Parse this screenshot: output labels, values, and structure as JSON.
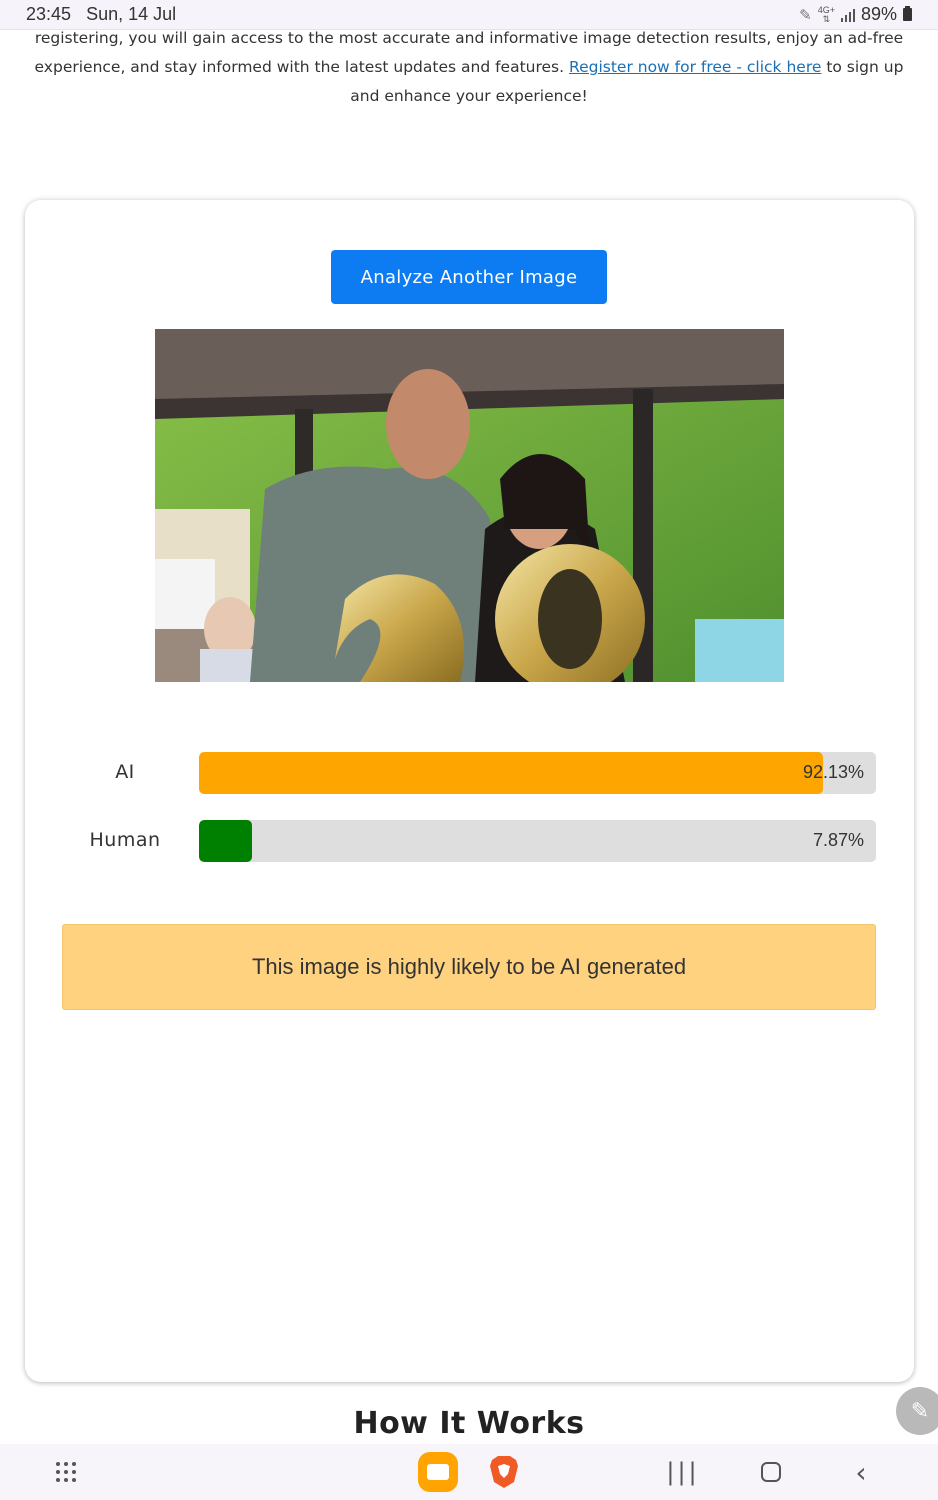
{
  "status_bar": {
    "time": "23:45",
    "date": "Sun, 14 Jul",
    "network": "4G+",
    "battery": "89%"
  },
  "intro": {
    "text_before": "registering, you will gain access to the most accurate and informative image detection results, enjoy an ad-free experience, and stay informed with the latest updates and features. ",
    "link_text": "Register now for free - click here",
    "text_after": " to sign up and enhance your experience!"
  },
  "card": {
    "analyze_button": "Analyze Another Image",
    "results": [
      {
        "label": "AI",
        "value_text": "92.13%",
        "percent": 92.13,
        "color": "#ffa500"
      },
      {
        "label": "Human",
        "value_text": "7.87%",
        "percent": 7.87,
        "color": "#008000"
      }
    ],
    "verdict": "This image is highly likely to be AI generated"
  },
  "section_title": "How It Works",
  "colors": {
    "accent_blue": "#0d7cf2",
    "verdict_bg": "#ffd27f",
    "link": "#1a6fb5"
  },
  "icons": {
    "status": [
      "pencil-icon",
      "network-icon",
      "signal-icon",
      "battery-icon"
    ],
    "nav": [
      "apps-grid-icon",
      "files-app-icon",
      "brave-browser-icon",
      "recents-icon",
      "home-icon",
      "back-icon"
    ],
    "fab": "edit-icon"
  }
}
